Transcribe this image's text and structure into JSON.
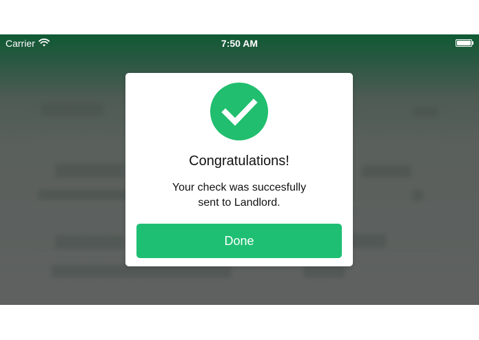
{
  "status_bar": {
    "carrier": "Carrier",
    "time": "7:50 AM",
    "battery_level": 1.0,
    "wifi_icon": "wifi-icon",
    "battery_icon": "battery-icon"
  },
  "dialog": {
    "icon": "checkmark-circle-icon",
    "title": "Congratulations!",
    "message_line1": "Your check was succesfully",
    "message_line2": "sent to Landlord.",
    "done_label": "Done"
  },
  "colors": {
    "accent": "#1fbf73",
    "header_green": "#0f5a33",
    "overlay": "#5e6160",
    "dialog_bg": "#ffffff"
  }
}
